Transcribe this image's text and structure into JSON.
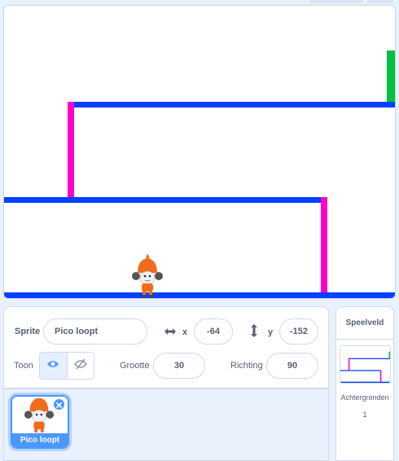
{
  "stage": {
    "sprite_name": "Pico",
    "colors": {
      "platform": "#0040ff",
      "wall": "#ff00c8",
      "goal": "#00c040"
    }
  },
  "sprite_info": {
    "sprite_label": "Sprite",
    "sprite_name": "Pico loopt",
    "x_label": "x",
    "x_value": "-64",
    "y_label": "y",
    "y_value": "-152",
    "show_label": "Toon",
    "size_label": "Grootte",
    "size_value": "30",
    "direction_label": "Richting",
    "direction_value": "90",
    "icons": {
      "x": "horizontal-arrows-icon",
      "y": "vertical-arrows-icon",
      "show": "eye-icon",
      "hide": "eye-slash-icon"
    }
  },
  "sprite_list": {
    "items": [
      {
        "label": "Pico loopt",
        "selected": true
      }
    ]
  },
  "stage_pane": {
    "title": "Speelveld",
    "backdrops_label": "Achtergronden",
    "backdrops_count": "1"
  },
  "colors": {
    "accent": "#4c97ff",
    "text": "#575e75"
  }
}
